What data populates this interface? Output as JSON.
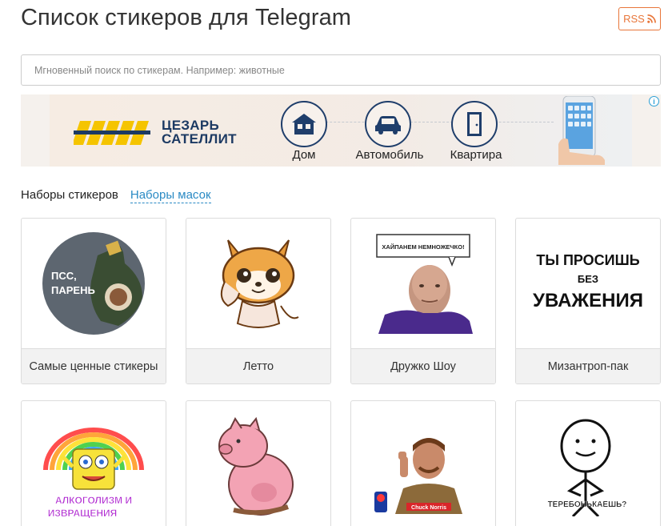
{
  "header": {
    "title": "Список стикеров для Telegram",
    "rss_label": "RSS"
  },
  "search": {
    "placeholder": "Мгновенный поиск по стикерам. Например: животные",
    "value": ""
  },
  "ad": {
    "brand_line1": "ЦЕЗАРЬ",
    "brand_line2": "САТЕЛЛИТ",
    "items": [
      {
        "label": "Дом",
        "icon": "house-icon"
      },
      {
        "label": "Автомобиль",
        "icon": "car-icon"
      },
      {
        "label": "Квартира",
        "icon": "door-icon"
      }
    ],
    "info_glyph": "i",
    "colors": {
      "brand": "#1c3a63",
      "stripes": "#f5c400"
    }
  },
  "tabs": [
    {
      "label": "Наборы стикеров",
      "active": true
    },
    {
      "label": "Наборы масок",
      "active": false
    }
  ],
  "sticker_sets": [
    {
      "name": "Самые ценные стикеры",
      "preview_text": "ПСС, ПАРЕНЬ"
    },
    {
      "name": "Летто",
      "preview_text": ""
    },
    {
      "name": "Дружко Шоу",
      "preview_text": "ХАЙПАНЕМ НЕМНОЖЕЧКО!"
    },
    {
      "name": "Мизантроп-пак",
      "preview_text_1": "ТЫ ПРОСИШЬ",
      "preview_text_2": "БЕЗ",
      "preview_text_3": "УВАЖЕНИЯ"
    },
    {
      "name": "",
      "preview_text_1": "АЛКОГОЛИЗМ И",
      "preview_text_2": "ИЗВРАЩЕНИЯ"
    },
    {
      "name": "",
      "preview_text": ""
    },
    {
      "name": "",
      "preview_text": "Chuck Norris"
    },
    {
      "name": "",
      "preview_text": "ТЕРЕБОНЬКАЕШЬ?"
    }
  ],
  "colors": {
    "accent": "#2a8ac4",
    "rss": "#e8763a"
  }
}
